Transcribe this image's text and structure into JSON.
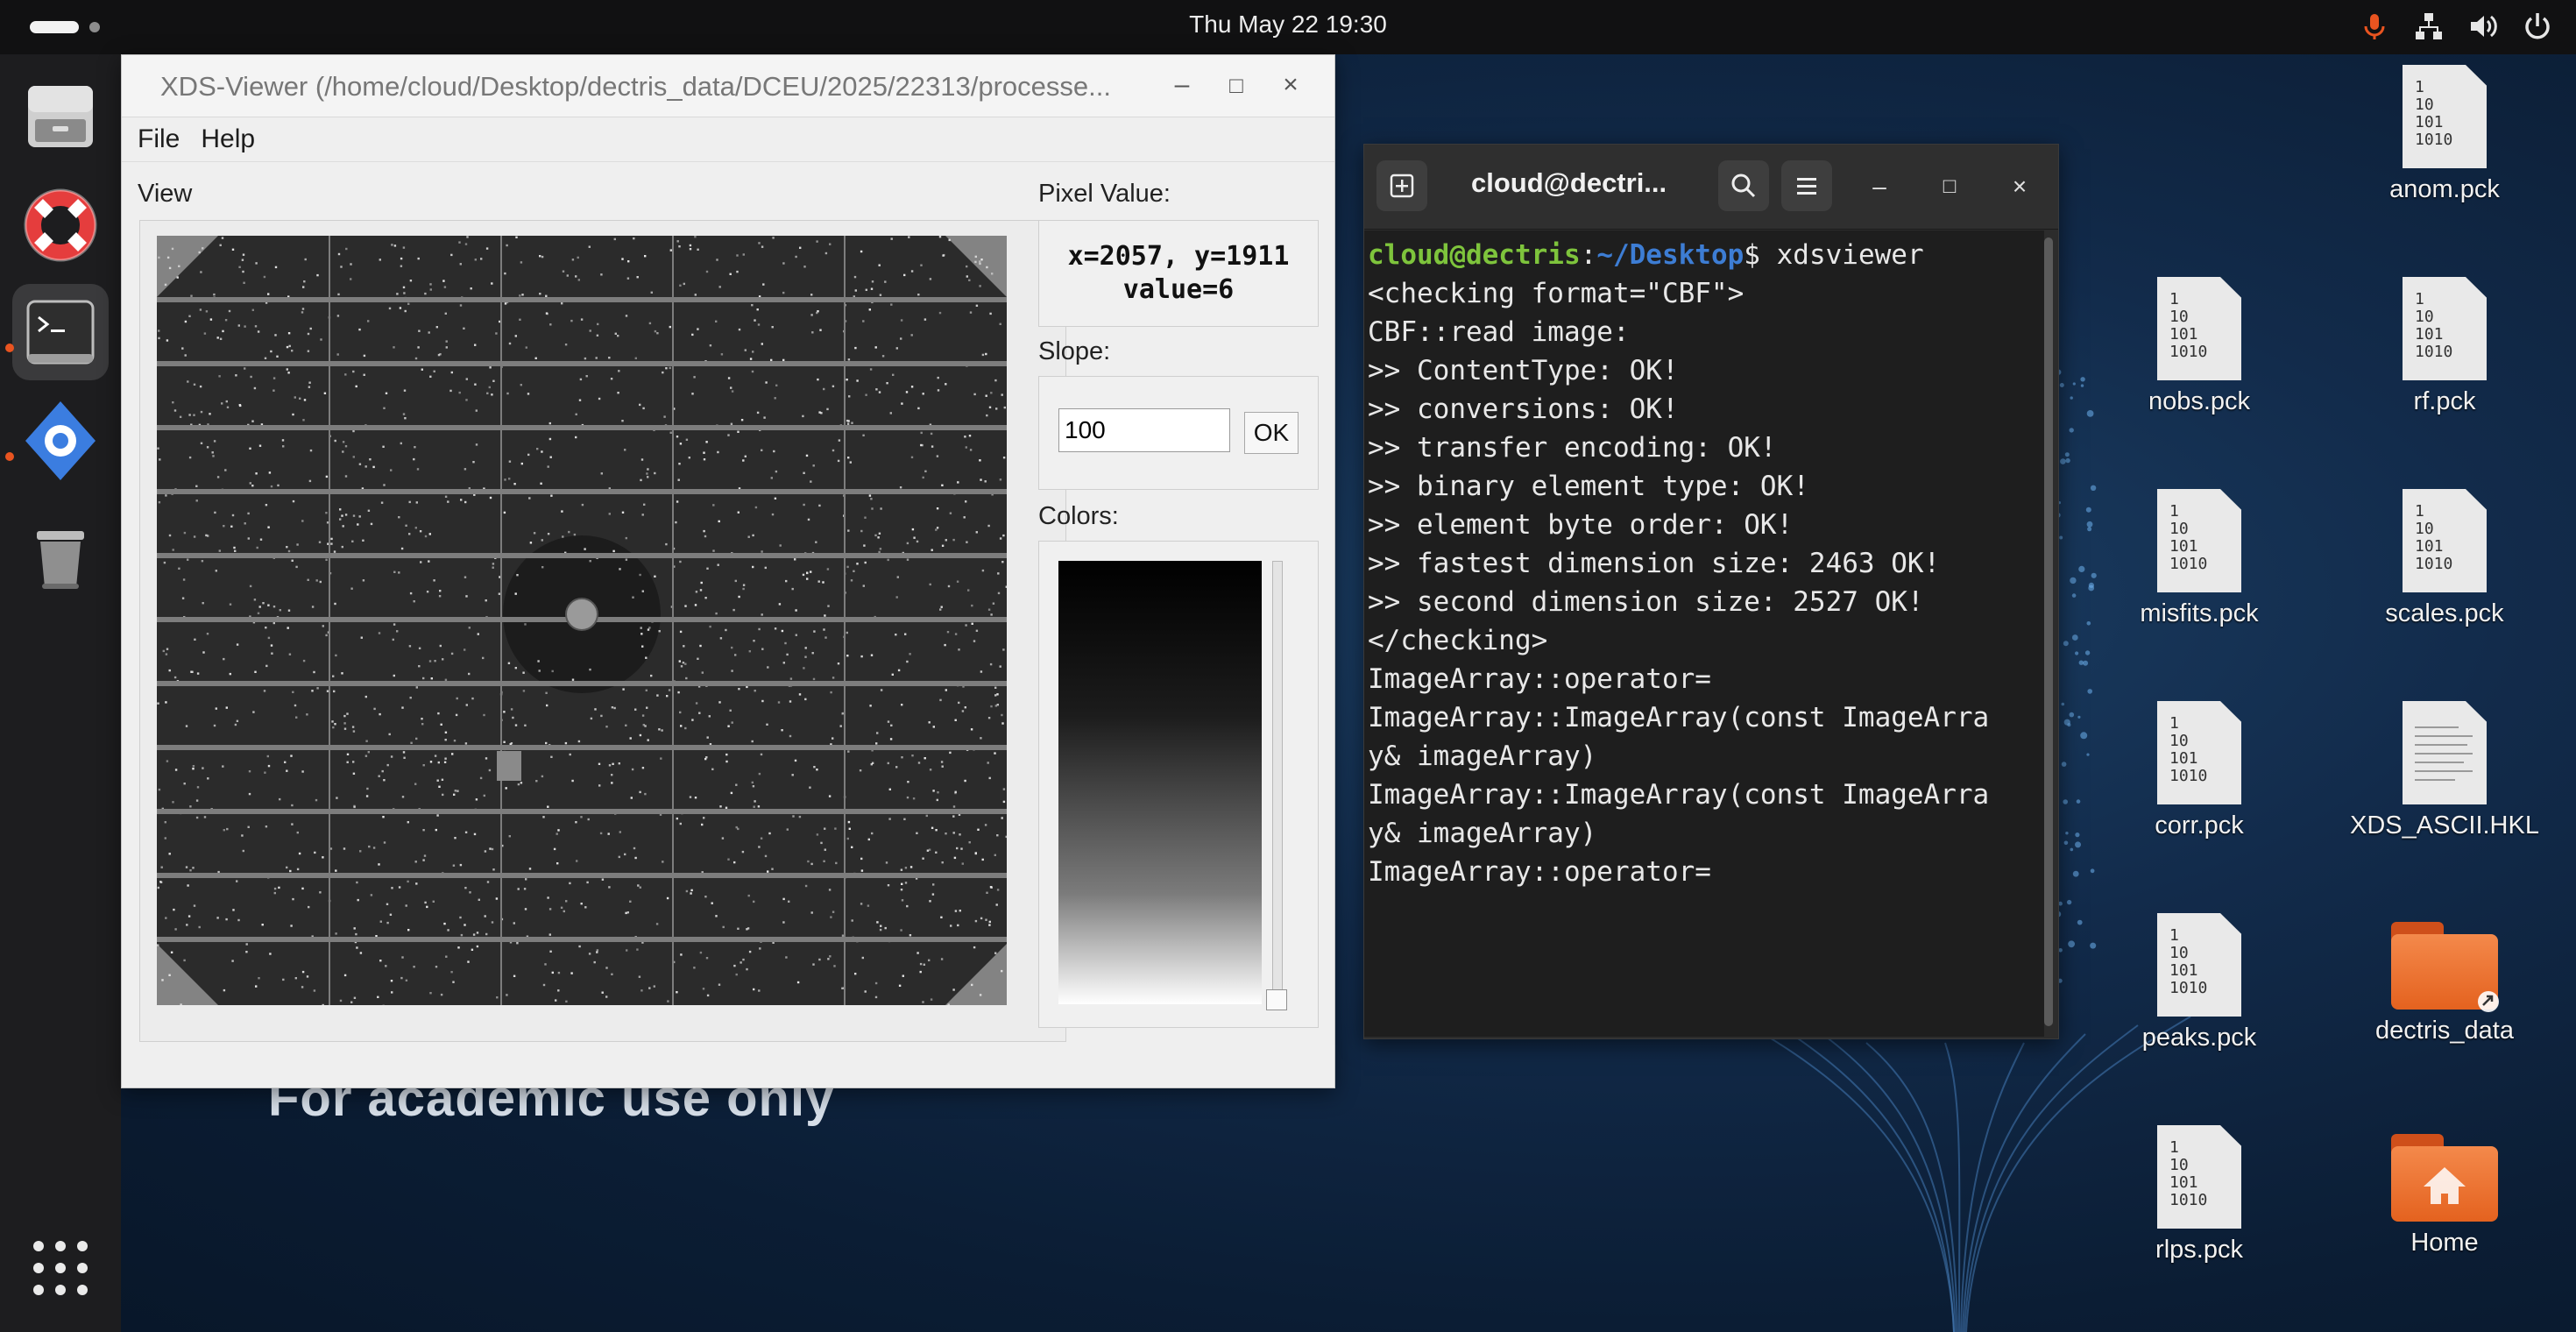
{
  "topbar": {
    "clock": "Thu May 22  19:30",
    "tray_icons": [
      "microphone-icon",
      "network-icon",
      "volume-icon",
      "power-icon"
    ]
  },
  "dock": {
    "items": [
      {
        "name": "files",
        "icon": "file-cabinet-icon"
      },
      {
        "name": "help",
        "icon": "lifebuoy-icon"
      },
      {
        "name": "terminal",
        "icon": "terminal-icon",
        "active": true
      },
      {
        "name": "software",
        "icon": "gear-icon"
      },
      {
        "name": "trash",
        "icon": "trash-icon"
      }
    ],
    "apps_grid_icon": "apps-grid-icon"
  },
  "wallpaper": {
    "watermark": "For academic use only"
  },
  "xds_window": {
    "title": "XDS-Viewer (/home/cloud/Desktop/dectris_data/DCEU/2025/22313/processe...",
    "controls": {
      "minimize": "–",
      "maximize": "□",
      "close": "×"
    },
    "menu": [
      "File",
      "Help"
    ],
    "view_label": "View",
    "pixel_value_label": "Pixel Value:",
    "pixel_value_line1": "x=2057, y=1911",
    "pixel_value_line2": "value=6",
    "slope_label": "Slope:",
    "slope_value": "100",
    "ok_label": "OK",
    "colors_label": "Colors:"
  },
  "terminal": {
    "title": "cloud@dectri...",
    "prompt_user": "cloud@dectris",
    "prompt_sep": ":",
    "prompt_path": "~/Desktop",
    "prompt_dollar": "$",
    "command": " xdsviewer",
    "output": [
      "<checking format=\"CBF\">",
      "CBF::read image:",
      ">> ContentType: OK!",
      ">> conversions: OK!",
      ">> transfer encoding: OK!",
      ">> binary element type: OK!",
      ">> element byte order: OK!",
      ">> fastest dimension size: 2463 OK!",
      ">> second dimension size: 2527 OK!",
      "</checking>",
      "ImageArray::operator=",
      "ImageArray::ImageArray(const ImageArra",
      "y& imageArray)",
      "ImageArray::ImageArray(const ImageArra",
      "y& imageArray)",
      "ImageArray::operator="
    ]
  },
  "desktop_icons": [
    {
      "label": "anom.pck",
      "type": "binary"
    },
    {
      "label": "nobs.pck",
      "type": "binary"
    },
    {
      "label": "rf.pck",
      "type": "binary"
    },
    {
      "label": "misfits.pck",
      "type": "binary"
    },
    {
      "label": "scales.pck",
      "type": "binary"
    },
    {
      "label": "corr.pck",
      "type": "binary"
    },
    {
      "label": "XDS_ASCII.HKL",
      "type": "text"
    },
    {
      "label": "peaks.pck",
      "type": "binary"
    },
    {
      "label": "dectris_data",
      "type": "folder-link"
    },
    {
      "label": "rlps.pck",
      "type": "binary"
    },
    {
      "label": "Home",
      "type": "home-folder"
    }
  ],
  "binary_glyph": [
    "1",
    "10",
    "101",
    "1010"
  ]
}
